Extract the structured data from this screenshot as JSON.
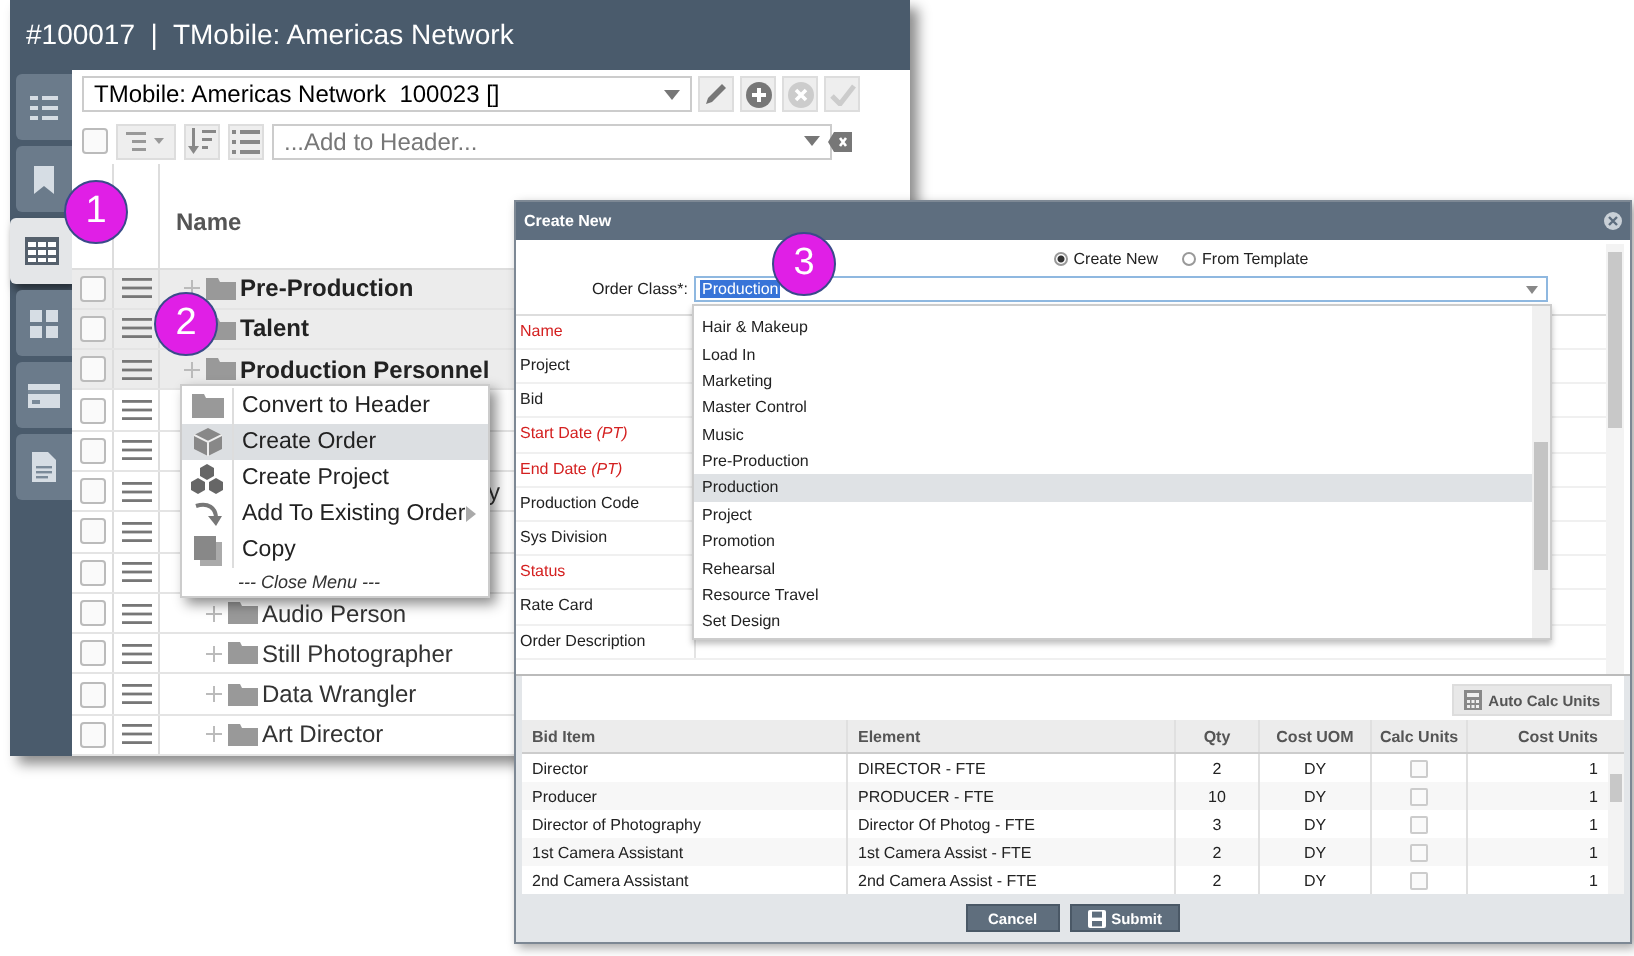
{
  "main_window": {
    "title": "#100017  |  TMobile: Americas Network",
    "rail": [
      {
        "kind": "list",
        "selected": false
      },
      {
        "kind": "bookmark",
        "selected": false
      },
      {
        "kind": "grid",
        "selected": true
      },
      {
        "kind": "tiles",
        "selected": false
      },
      {
        "kind": "card",
        "selected": false
      },
      {
        "kind": "document",
        "selected": false
      }
    ],
    "header_select": {
      "value": "TMobile: Americas Network  100023 []"
    },
    "add_field": {
      "placeholder": "...Add to Header..."
    },
    "select_all": {
      "checked": false
    },
    "grid": {
      "column": "Name",
      "rows": [
        {
          "kind": "group",
          "name": "Pre-Production",
          "checked": false
        },
        {
          "kind": "group",
          "name": "Talent",
          "checked": false
        },
        {
          "kind": "group",
          "name": "Production Personnel",
          "checked": false
        },
        {
          "kind": "covered",
          "checked": false
        },
        {
          "kind": "covered",
          "checked": false
        },
        {
          "kind": "peek",
          "name": "y",
          "checked": false
        },
        {
          "kind": "covered",
          "checked": false
        },
        {
          "kind": "covered",
          "checked": false
        },
        {
          "kind": "item",
          "name": "Audio Person",
          "checked": false
        },
        {
          "kind": "item",
          "name": "Still Photographer",
          "checked": false
        },
        {
          "kind": "item",
          "name": "Data Wrangler",
          "checked": false
        },
        {
          "kind": "item",
          "name": "Art Director",
          "checked": false
        }
      ]
    }
  },
  "context_menu": {
    "items": [
      {
        "label": "Convert to Header",
        "selected": false,
        "submenu": false
      },
      {
        "label": "Create Order",
        "selected": true,
        "submenu": false
      },
      {
        "label": "Create Project",
        "selected": false,
        "submenu": false
      },
      {
        "label": "Add To Existing Order",
        "selected": false,
        "submenu": true
      },
      {
        "label": "Copy",
        "selected": false,
        "submenu": false
      }
    ],
    "close_label": "--- Close Menu ---"
  },
  "dialog": {
    "title": "Create New",
    "modes": [
      {
        "label": "Create New",
        "selected": true
      },
      {
        "label": "From Template",
        "selected": false
      }
    ],
    "order_class": {
      "label": "Order Class*:",
      "value": "Production"
    },
    "options": [
      {
        "label": "Hair & Makeup",
        "selected": false
      },
      {
        "label": "Load In",
        "selected": false
      },
      {
        "label": "Marketing",
        "selected": false
      },
      {
        "label": "Master Control",
        "selected": false
      },
      {
        "label": "Music",
        "selected": false
      },
      {
        "label": "Pre-Production",
        "selected": false
      },
      {
        "label": "Production",
        "selected": true
      },
      {
        "label": "Project",
        "selected": false
      },
      {
        "label": "Promotion",
        "selected": false
      },
      {
        "label": "Rehearsal",
        "selected": false
      },
      {
        "label": "Resource Travel",
        "selected": false
      },
      {
        "label": "Set Design",
        "selected": false
      }
    ],
    "fields": [
      {
        "label": "Name",
        "required": true
      },
      {
        "label": "Project",
        "required": false
      },
      {
        "label": "Bid",
        "required": false
      },
      {
        "label": "Start Date *(PT)*",
        "required": true
      },
      {
        "label": "End Date *(PT)*",
        "required": true
      },
      {
        "label": "Production Code",
        "required": false
      },
      {
        "label": "Sys Division",
        "required": false
      },
      {
        "label": "Status",
        "required": true
      },
      {
        "label": "Rate Card",
        "required": false
      },
      {
        "label": "Order Description",
        "required": false
      }
    ],
    "auto_calc_button": "Auto Calc Units",
    "table": {
      "columns": [
        "Bid Item",
        "Element",
        "Qty",
        "Cost UOM",
        "Calc Units",
        "Cost Units"
      ],
      "rows": [
        {
          "bid_item": "Director",
          "element": "DIRECTOR - FTE",
          "qty": "2",
          "cost_uom": "DY",
          "calc_units": false,
          "cost_units": "1"
        },
        {
          "bid_item": "Producer",
          "element": "PRODUCER - FTE",
          "qty": "10",
          "cost_uom": "DY",
          "calc_units": false,
          "cost_units": "1"
        },
        {
          "bid_item": "Director of Photography",
          "element": "Director Of Photog - FTE",
          "qty": "3",
          "cost_uom": "DY",
          "calc_units": false,
          "cost_units": "1"
        },
        {
          "bid_item": "1st Camera Assistant",
          "element": "1st Camera Assist - FTE",
          "qty": "2",
          "cost_uom": "DY",
          "calc_units": false,
          "cost_units": "1"
        },
        {
          "bid_item": "2nd Camera Assistant",
          "element": "2nd Camera Assist - FTE",
          "qty": "2",
          "cost_uom": "DY",
          "calc_units": false,
          "cost_units": "1"
        }
      ]
    },
    "buttons": [
      {
        "kind": "cancel",
        "label": "Cancel"
      },
      {
        "kind": "submit",
        "label": "Submit"
      }
    ]
  },
  "callouts": [
    {
      "kind": "rail",
      "label": "1"
    },
    {
      "kind": "menu",
      "label": "2"
    },
    {
      "kind": "dialog",
      "label": "3"
    }
  ]
}
